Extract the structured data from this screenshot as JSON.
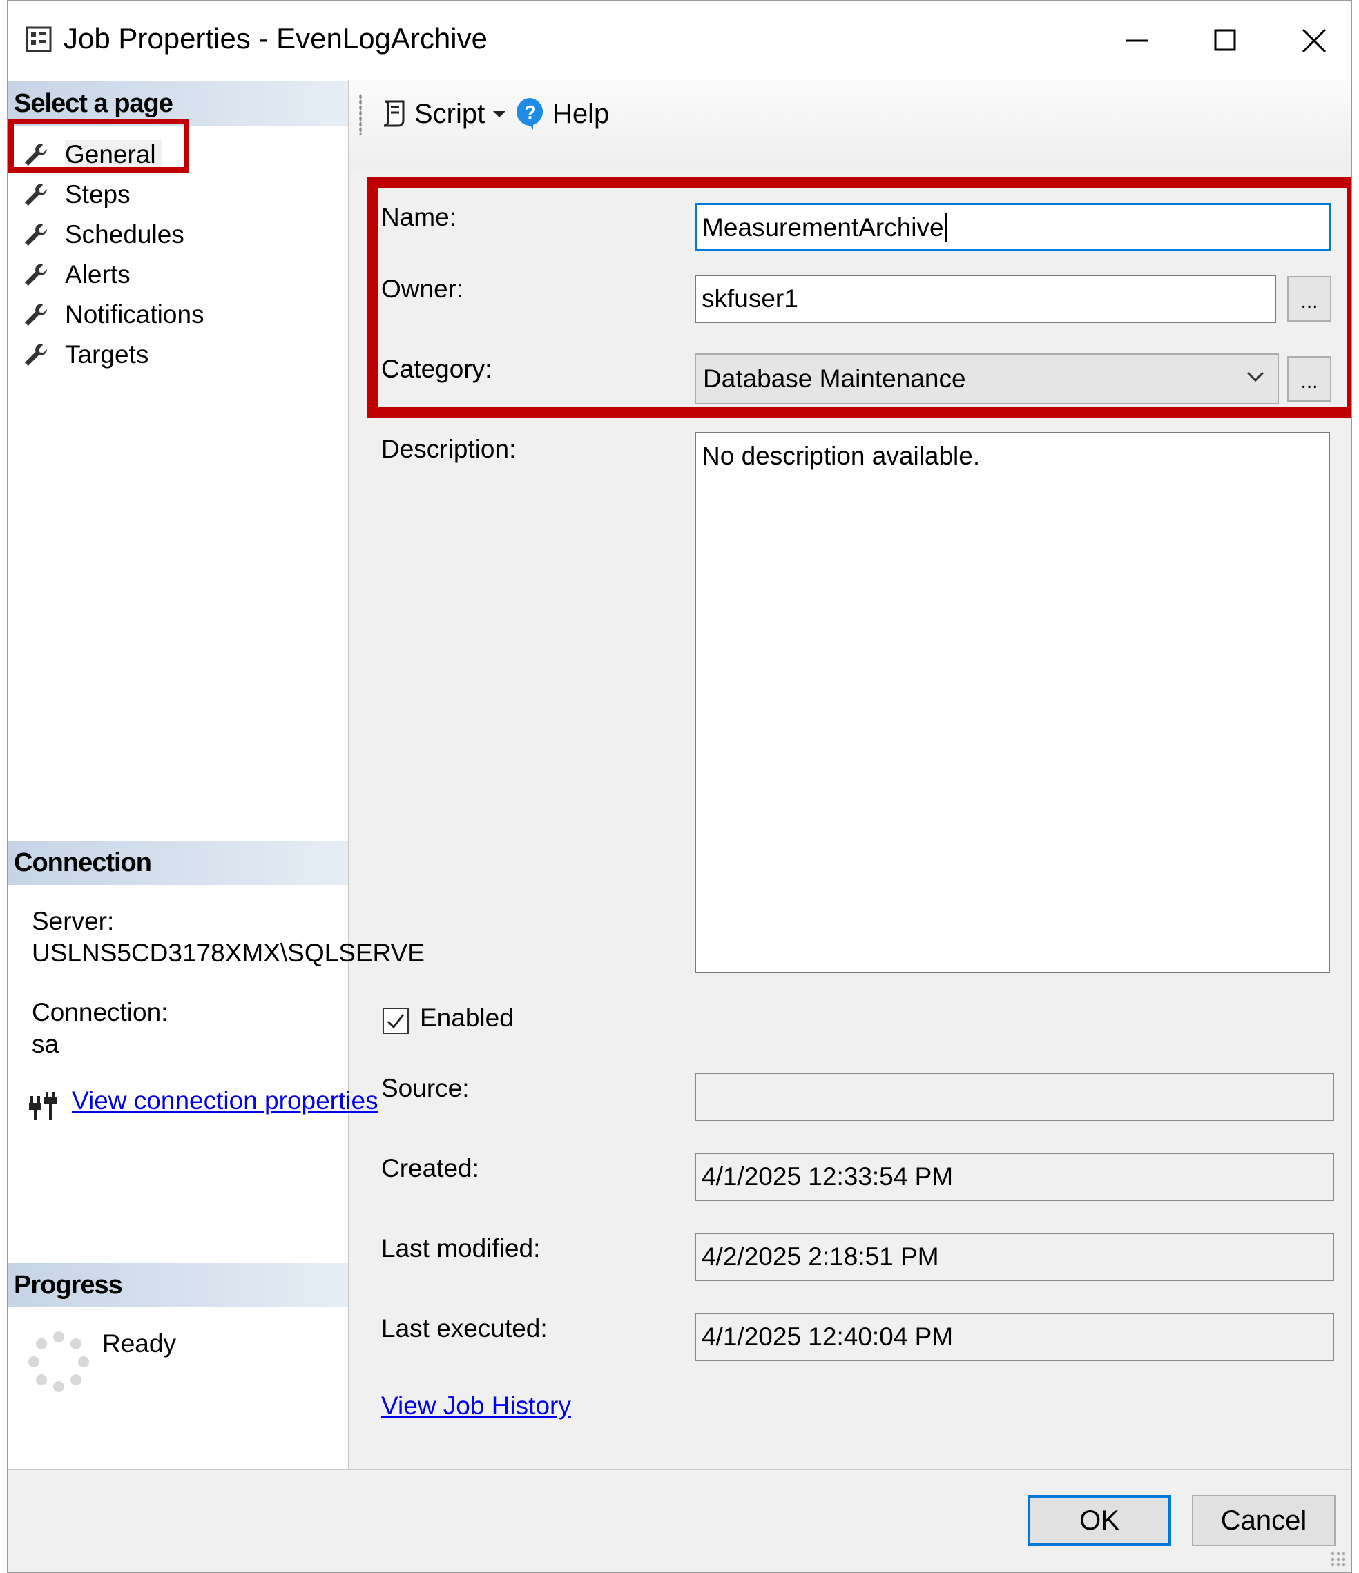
{
  "window": {
    "title": "Job Properties - EvenLogArchive",
    "icon": "dialog-window-icon"
  },
  "window_controls": {
    "minimize_icon": "minimize-icon",
    "maximize_icon": "maximize-icon",
    "close_icon": "close-icon"
  },
  "left_pane": {
    "select_page_header": "Select a page",
    "pages": [
      {
        "label": "General",
        "selected": true,
        "icon": "wrench-icon"
      },
      {
        "label": "Steps",
        "icon": "wrench-icon"
      },
      {
        "label": "Schedules",
        "icon": "wrench-icon"
      },
      {
        "label": "Alerts",
        "icon": "wrench-icon"
      },
      {
        "label": "Notifications",
        "icon": "wrench-icon"
      },
      {
        "label": "Targets",
        "icon": "wrench-icon"
      }
    ],
    "connection_header": "Connection",
    "server_label": "Server:",
    "server_value": "USLNS5CD3178XMX\\SQLSERVE",
    "connection_label": "Connection:",
    "connection_value": "sa",
    "view_connection_link": "View connection properties",
    "progress_header": "Progress",
    "progress_status": "Ready"
  },
  "toolbar": {
    "script_label": "Script",
    "help_label": "Help"
  },
  "form": {
    "name_label": "Name:",
    "name_value": "MeasurementArchive",
    "owner_label": "Owner:",
    "owner_value": "skfuser1",
    "owner_browse": "...",
    "category_label": "Category:",
    "category_value": "Database Maintenance",
    "category_browse": "...",
    "description_label": "Description:",
    "description_value": "No description available.",
    "enabled_label": "Enabled",
    "enabled_checked": true,
    "source_label": "Source:",
    "source_value": "",
    "created_label": "Created:",
    "created_value": "4/1/2025 12:33:54 PM",
    "last_modified_label": "Last modified:",
    "last_modified_value": "4/2/2025 2:18:51 PM",
    "last_executed_label": "Last executed:",
    "last_executed_value": "4/1/2025 12:40:04 PM",
    "view_job_history_link": "View Job History"
  },
  "buttons": {
    "ok_label": "OK",
    "cancel_label": "Cancel"
  },
  "colors": {
    "highlight_box": "#c00000",
    "link": "#0000ee",
    "focus": "#0078d7"
  }
}
